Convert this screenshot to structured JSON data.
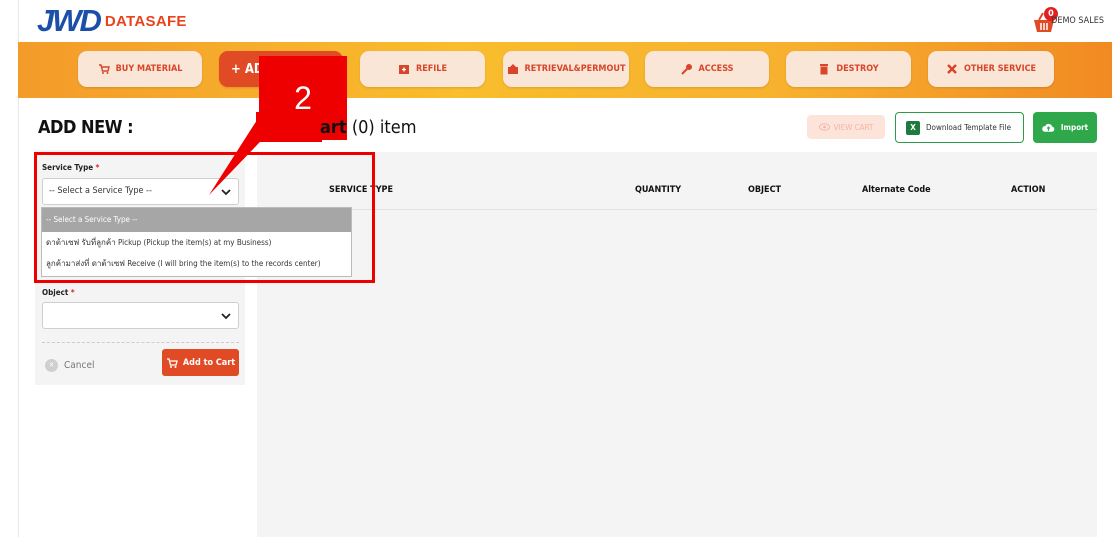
{
  "brand": {
    "logo_mark": "JWD",
    "logo_text": "DATASAFE"
  },
  "header": {
    "cart_count": "0",
    "user_name": "DEMO SALES"
  },
  "nav": {
    "buy_material": "BUY MATERIAL",
    "add_new": "+ AD",
    "refile": "REFILE",
    "retrieval": "RETRIEVAL&PERMOUT",
    "access": "ACCESS",
    "destroy": "DESTROY",
    "other_service": "OTHER SERVICE"
  },
  "callout": {
    "number": "2"
  },
  "page": {
    "title": "ADD NEW :",
    "cart_title_bold": "art",
    "cart_title_rest": " (0) item"
  },
  "toolbar": {
    "view_cart": "VIEW CART",
    "download_template": "Download Template File",
    "import": "Import"
  },
  "form": {
    "service_type_label": "Service Type",
    "service_type_value": "-- Select a Service Type --",
    "object_label": "Object",
    "object_value": "",
    "required_mark": "*",
    "cancel": "Cancel",
    "add_to_cart": "Add to Cart"
  },
  "dropdown": {
    "options": [
      "-- Select a Service Type --",
      "ดาต้าเซฟ รับที่ลูกค้า Pickup (Pickup the item(s) at my Business)",
      "ลูกค้ามาส่งที่ ดาต้าเซฟ Receive (I will bring the item(s) to the records center)"
    ]
  },
  "table": {
    "headers": [
      "SERVICE TYPE",
      "QUANTITY",
      "OBJECT",
      "Alternate Code",
      "ACTION"
    ]
  },
  "colors": {
    "brand_blue": "#1b4fa8",
    "brand_orange": "#e04a25",
    "nav_gradient_start": "#f49b2a",
    "highlight_red": "#ee0000",
    "import_green": "#2fa84c"
  }
}
